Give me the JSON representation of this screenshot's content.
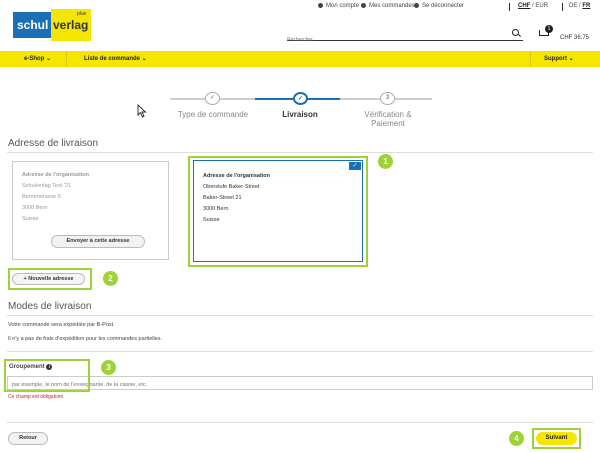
{
  "header": {
    "logo_text_1": "schul",
    "logo_text_2": "verlag",
    "logo_plus": "plus",
    "links": {
      "account": "Mon compte",
      "orders": "Mes commandes",
      "logout": "Se déconnecter",
      "currency_active": "CHF",
      "currency_sep": "/",
      "currency_other": "EUR",
      "lang_de": "DE",
      "lang_sep": "/",
      "lang_fr": "FR"
    },
    "search_placeholder": "Rechercher...",
    "cart_count": "1",
    "cart_total": "CHF 36.75"
  },
  "nav": {
    "eshop": "e-Shop",
    "order_list": "Liste de commande",
    "support": "Support"
  },
  "stepper": {
    "steps": [
      {
        "label": "Type de commande",
        "marker": "✓",
        "state": "done"
      },
      {
        "label": "Livraison",
        "marker": "✓",
        "state": "active"
      },
      {
        "label": "Vérification & Paiement",
        "marker": "3",
        "state": "todo"
      }
    ]
  },
  "delivery_address": {
    "heading": "Adresse de livraison",
    "cards": [
      {
        "title": "Adresse de l'organisation",
        "lines": [
          "Schulverlag Test '21",
          "Bernerstrasse 5",
          "3000 Bern",
          "Suisse"
        ],
        "button": "Envoyer à cette adresse"
      },
      {
        "title": "Adresse de l'organisation",
        "lines": [
          "Oberstufe Baker-Street",
          "Baker-Street 21",
          "3000 Bern",
          "Suisse"
        ],
        "selected_mark": "✓"
      }
    ],
    "new_address_button": "+ Nouvelle adresse"
  },
  "shipping": {
    "heading": "Modes de livraison",
    "line1": "Votre commande sera expédiée par B-Post.",
    "line2": "Il n'y a pas de frais d'expédition pour les commandes partielles."
  },
  "grouping": {
    "label": "Groupement",
    "info_icon": "i",
    "placeholder": "par exemple, le nom de l'enseignante, de la classe, etc.",
    "error": "Ce champ est obligatoire."
  },
  "footer": {
    "back": "Retour",
    "next": "Suivant"
  },
  "annotations": [
    "1",
    "2",
    "3",
    "4"
  ],
  "colors": {
    "brand_yellow": "#f5e600",
    "brand_blue": "#1a6fb5",
    "highlight_green": "#9fd13a",
    "error_red": "#cc2222"
  }
}
